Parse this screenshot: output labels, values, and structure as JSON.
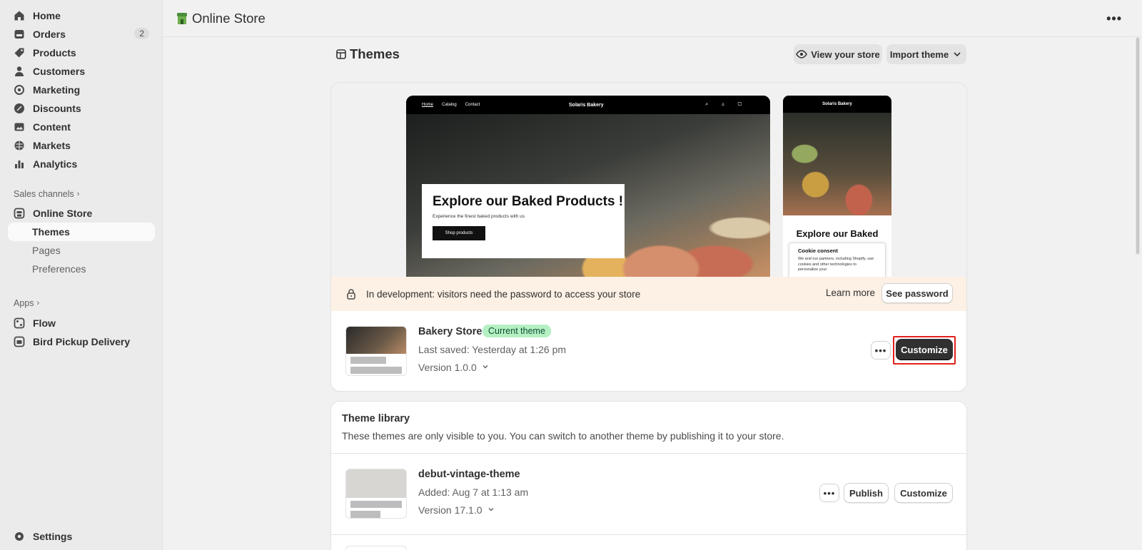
{
  "sidebar": {
    "items": [
      {
        "label": "Home",
        "icon": "home-icon"
      },
      {
        "label": "Orders",
        "icon": "orders-icon",
        "badge": "2"
      },
      {
        "label": "Products",
        "icon": "tag-icon"
      },
      {
        "label": "Customers",
        "icon": "person-icon"
      },
      {
        "label": "Marketing",
        "icon": "target-icon"
      },
      {
        "label": "Discounts",
        "icon": "discount-icon"
      },
      {
        "label": "Content",
        "icon": "image-icon"
      },
      {
        "label": "Markets",
        "icon": "globe-icon"
      },
      {
        "label": "Analytics",
        "icon": "bar-chart-icon"
      }
    ],
    "sales_channels_label": "Sales channels",
    "online_store": "Online Store",
    "sub_items": [
      "Themes",
      "Pages",
      "Preferences"
    ],
    "apps_label": "Apps",
    "apps": [
      "Flow",
      "Bird Pickup Delivery"
    ],
    "settings": "Settings"
  },
  "topbar": {
    "title": "Online Store",
    "more": "•••"
  },
  "page": {
    "title": "Themes",
    "view_store": "View your store",
    "import_theme": "Import theme"
  },
  "preview": {
    "nav": [
      "Home",
      "Catalog",
      "Contact"
    ],
    "brand": "Solaris Bakery",
    "hero_title": "Explore our Baked Products !",
    "hero_sub": "Experience the finest baked products with us",
    "hero_button": "Shop products",
    "mobile_title": "Explore our Baked",
    "cookie_title": "Cookie consent",
    "cookie_text": "We and our partners, including Shopify, use cookies and other technologies to personalize your"
  },
  "banner": {
    "text": "In development: visitors need the password to access your store",
    "learn_more": "Learn more",
    "see_password": "See password"
  },
  "current_theme": {
    "name": "Bakery Store",
    "badge": "Current theme",
    "saved": "Last saved: Yesterday at 1:26 pm",
    "version": "Version 1.0.0",
    "customize": "Customize"
  },
  "library": {
    "title": "Theme library",
    "description": "These themes are only visible to you. You can switch to another theme by publishing it to your store.",
    "themes": [
      {
        "name": "debut-vintage-theme",
        "added": "Added: Aug 7 at 1:13 am",
        "version": "Version 17.1.0",
        "publish": "Publish",
        "customize": "Customize"
      }
    ]
  },
  "colors": {
    "accent_dark": "#303030",
    "current_badge": "#b5f0c3",
    "banner_bg": "#fdf0e4",
    "highlight": "#e0201c"
  }
}
